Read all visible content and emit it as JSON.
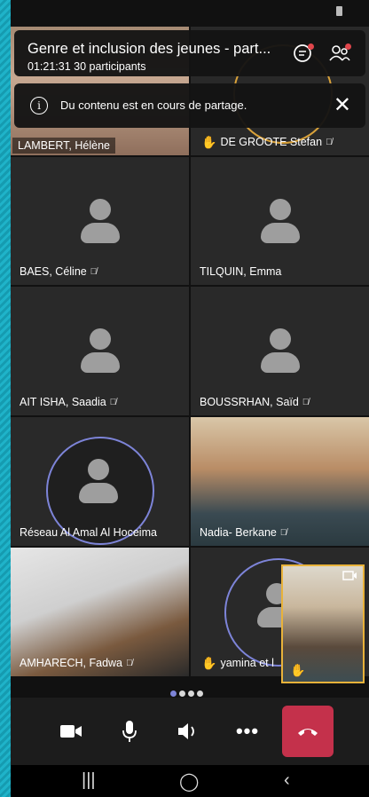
{
  "meeting": {
    "title": "Genre et inclusion des jeunes - part...",
    "duration": "01:21:31",
    "participants_label": "30 participants"
  },
  "share_notice": {
    "text": "Du contenu est en cours de partage."
  },
  "tiles": [
    {
      "name": "LAMBERT, Hélène",
      "muted": false,
      "hand": false
    },
    {
      "name": "DE GROOTE Stefan",
      "muted": true,
      "hand": true
    },
    {
      "name": "BAES, Céline",
      "muted": true,
      "hand": false
    },
    {
      "name": "TILQUIN, Emma",
      "muted": false,
      "hand": false
    },
    {
      "name": "AIT ISHA, Saadia",
      "muted": true,
      "hand": false
    },
    {
      "name": "BOUSSRHAN, Saïd",
      "muted": true,
      "hand": false
    },
    {
      "name": "Réseau Al Amal Al Hoceima",
      "muted": false,
      "hand": false
    },
    {
      "name": "Nadia- Berkane",
      "muted": true,
      "hand": false
    },
    {
      "name": "AMHARECH, Fadwa",
      "muted": true,
      "hand": false
    },
    {
      "name": "yamina et l",
      "muted": false,
      "hand": true
    }
  ],
  "pager": {
    "pages": 4,
    "current": 1
  },
  "colors": {
    "end_call": "#c4314b",
    "speaking_ring": "#7d84d8",
    "self_border": "#e8b23a",
    "tile_bg": "#292929"
  },
  "icons": {
    "chat": "chat-icon",
    "people": "people-icon",
    "info": "info-icon",
    "close": "close-icon",
    "camera": "video-camera-icon",
    "mic": "microphone-icon",
    "speaker": "speaker-icon",
    "more": "more-options-icon",
    "hangup": "hang-up-icon",
    "switch_camera": "switch-camera-icon"
  }
}
